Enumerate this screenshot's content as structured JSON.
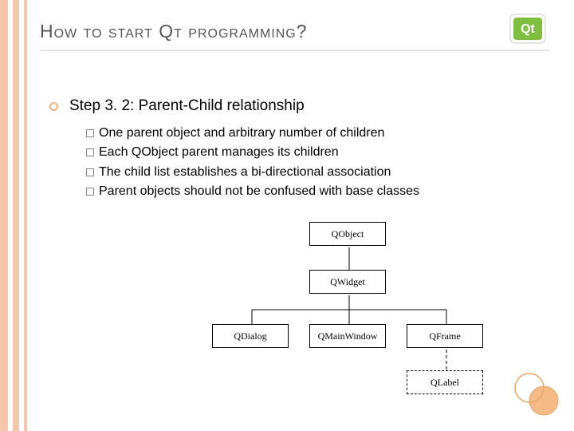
{
  "heading": "How to start Qt programming?",
  "step_line": "Step 3. 2: Parent-Child relationship",
  "bullets": [
    "One parent object and arbitrary number of children",
    "Each QObject parent manages its children",
    "The child list establishes a bi-directional association",
    "Parent objects should not be confused with base classes"
  ],
  "diagram": {
    "qobject": "QObject",
    "qwidget": "QWidget",
    "qdialog": "QDialog",
    "qmainwindow": "QMainWindow",
    "qframe": "QFrame",
    "qlabel": "QLabel"
  }
}
